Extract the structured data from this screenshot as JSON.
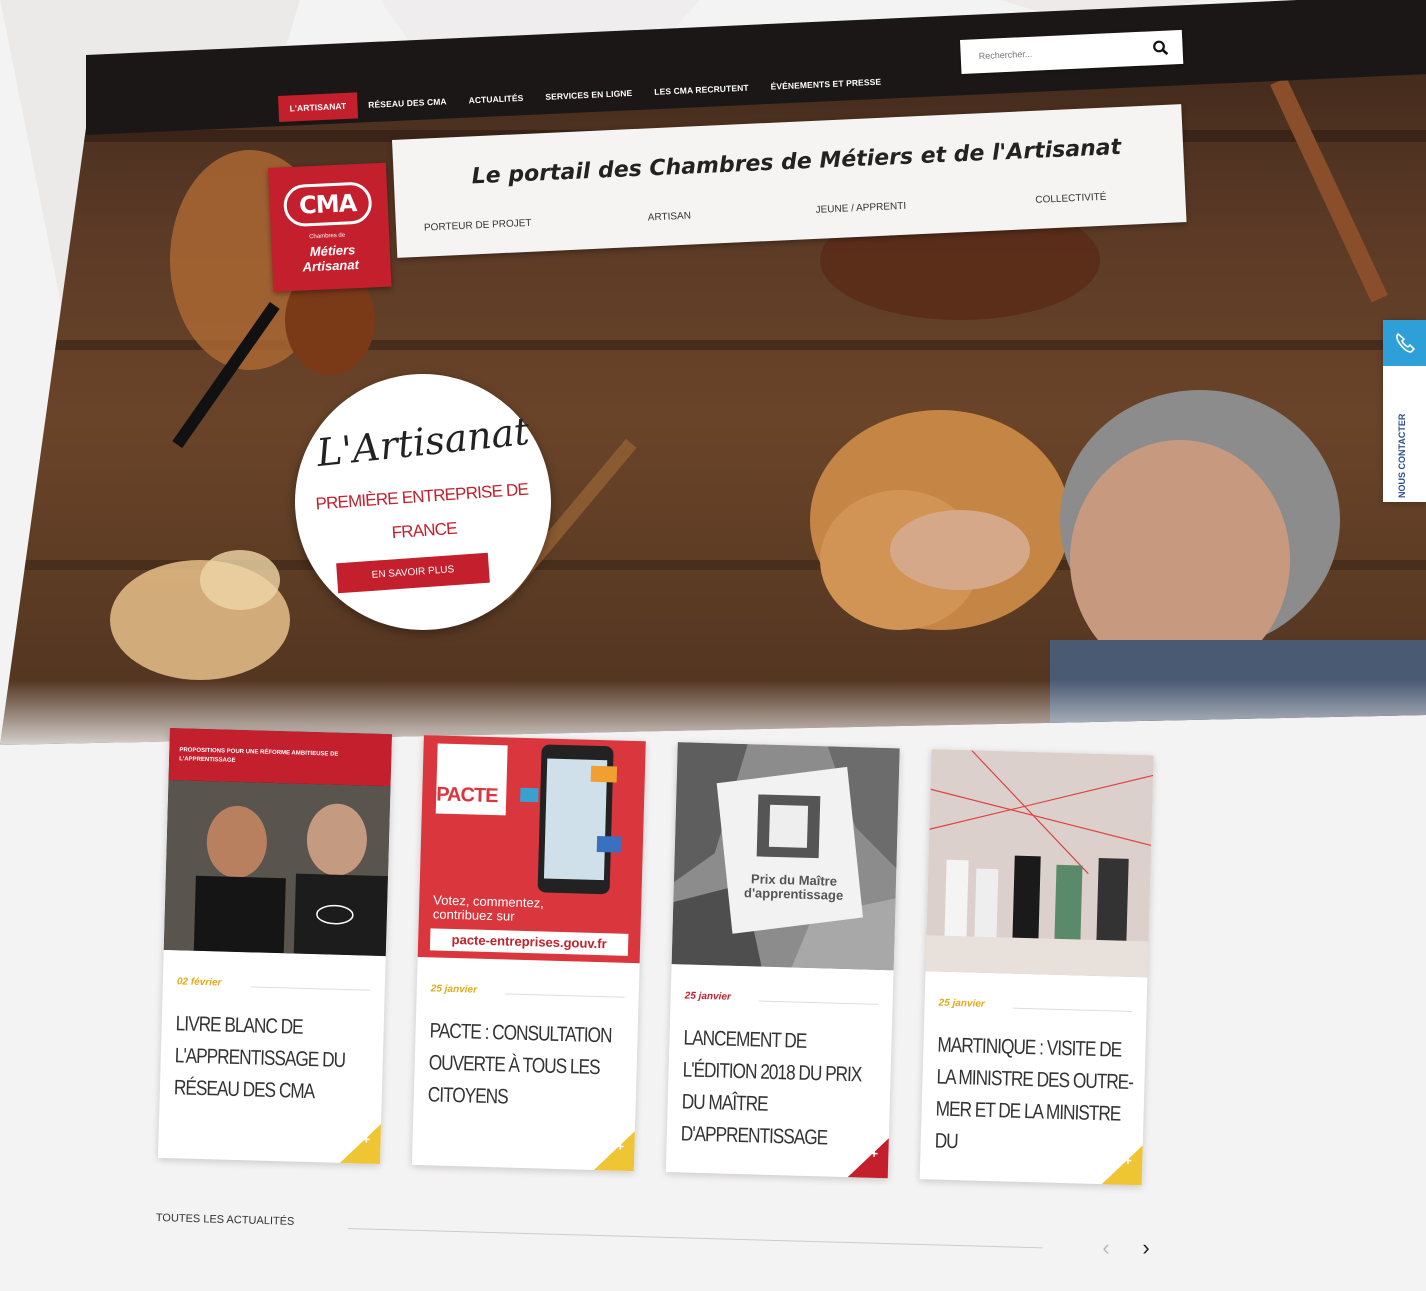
{
  "nav": {
    "items": [
      "L'ARTISANAT",
      "RÉSEAU DES CMA",
      "ACTUALITÉS",
      "SERVICES EN LIGNE",
      "LES CMA RECRUTENT",
      "ÉVÉNEMENTS ET PRESSE"
    ],
    "active_index": 0
  },
  "search": {
    "placeholder": "Rechercher..."
  },
  "header": {
    "title": "Le portail des Chambres de Métiers et de l'Artisanat",
    "audiences": [
      "PORTEUR DE PROJET",
      "ARTISAN",
      "JEUNE / APPRENTI",
      "COLLECTIVITÉ"
    ]
  },
  "logo": {
    "mark": "CMA",
    "line1": "Chambres de",
    "line2": "Métiers",
    "line3": "Artisanat"
  },
  "promo": {
    "script": "L'Artisanat",
    "subtitle": "PREMIÈRE ENTREPRISE DE FRANCE",
    "button": "EN SAVOIR PLUS"
  },
  "contact": {
    "label": "NOUS CONTACTER"
  },
  "cards": [
    {
      "image_caption": "PROPOSITIONS POUR UNE RÉFORME AMBITIEUSE DE L'APPRENTISSAGE",
      "date": "02 février",
      "title": "LIVRE BLANC DE L'APPRENTISSAGE DU RÉSEAU DES CMA",
      "accent": "yellow"
    },
    {
      "image_caption": "PACTE",
      "image_text1": "Votez, commentez, contribuez sur",
      "image_text2": "pacte-entreprises.gouv.fr",
      "date": "25 janvier",
      "title": "PACTE : CONSULTATION OUVERTE À TOUS LES CITOYENS",
      "accent": "yellow"
    },
    {
      "image_caption": "Prix du Maître d'apprentissage",
      "date": "25 janvier",
      "title": "LANCEMENT DE L'ÉDITION 2018 DU PRIX DU MAÎTRE D'APPRENTISSAGE",
      "accent": "red"
    },
    {
      "date": "25 janvier",
      "title": "MARTINIQUE : VISITE DE LA MINISTRE DES OUTRE-MER ET DE LA MINISTRE DU",
      "accent": "yellow"
    }
  ],
  "all_news": "TOUTES LES ACTUALITÉS",
  "colors": {
    "brand_red": "#c31f2c",
    "accent_yellow": "#f0c534",
    "contact_blue": "#2f9fd8"
  }
}
